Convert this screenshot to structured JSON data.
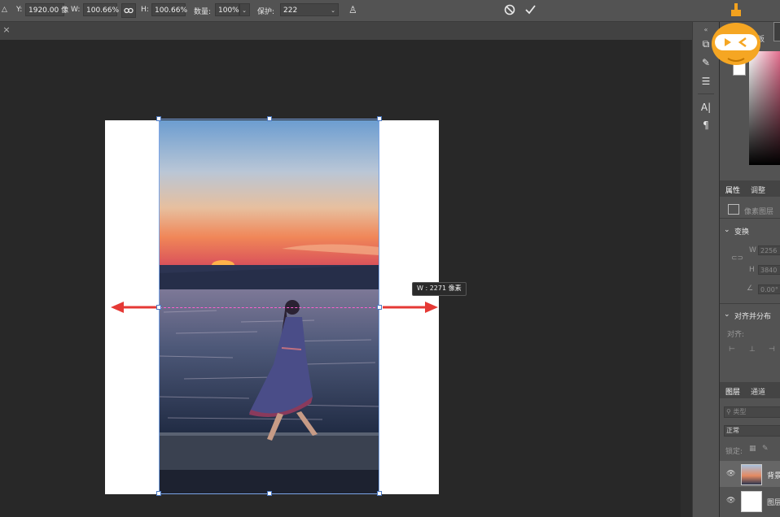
{
  "options_bar": {
    "ref_icon": "triangle-icon",
    "y_label": "Y:",
    "y_value": "1920.00 像",
    "w_label": "W:",
    "w_value": "100.66%",
    "h_label": "H:",
    "h_value": "100.66%",
    "amount_label": "数量:",
    "amount_value": "100%",
    "protect_label": "保护:",
    "protect_value": "222",
    "cancel_icon": "cancel-icon",
    "commit_icon": "checkmark-icon"
  },
  "tab": {
    "close": "×"
  },
  "canvas": {
    "tooltip": "W : 2271 像素"
  },
  "panels": {
    "swatch_tab": "板",
    "properties_tab": "属性",
    "adjust_tab": "调整",
    "pixel_layer": "像素图层",
    "transform_header": "变换",
    "w_label": "W",
    "w_value": "2256",
    "h_label": "H",
    "h_value": "3840",
    "angle_value": "0.00°",
    "align_header": "对齐并分布",
    "align_label": "对齐:",
    "layers_tab": "图层",
    "channels_tab": "通道",
    "search_placeholder": "类型",
    "blend_mode": "正常",
    "lock_label": "锁定:",
    "layers": [
      {
        "name": "背景"
      },
      {
        "name": "图层"
      }
    ]
  },
  "tools": [
    "history-brush-icon",
    "brush-settings-icon",
    "sliders-icon",
    "text-icon",
    "paragraph-icon"
  ],
  "colors": {
    "accent": "#e53935",
    "selection": "#7aa4e6",
    "guide": "#ff5fd0"
  }
}
